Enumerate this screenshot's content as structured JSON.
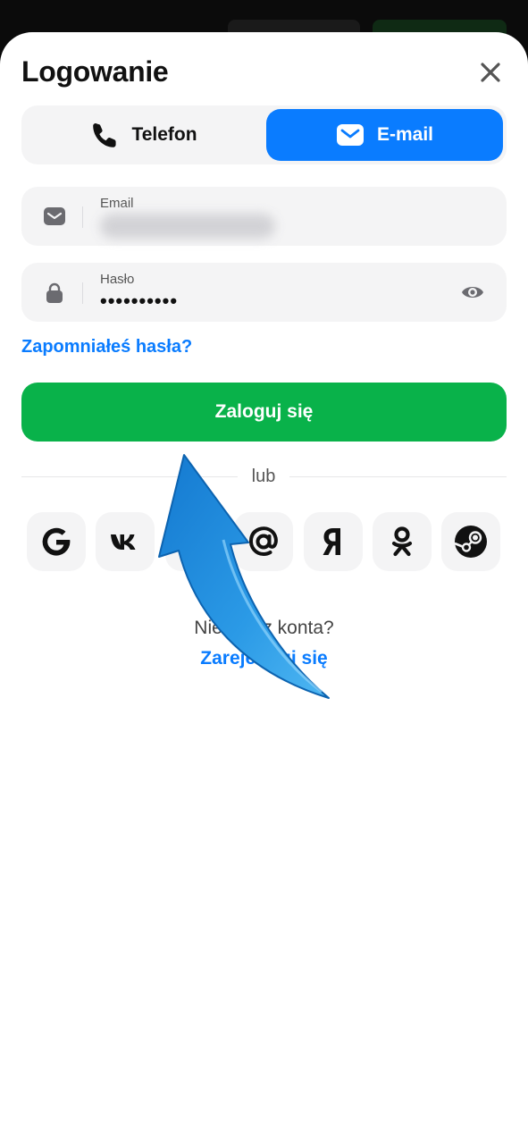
{
  "header": {
    "title": "Logowanie",
    "close_icon": "close-icon"
  },
  "tabs": [
    {
      "label": "Telefon",
      "icon": "phone-icon",
      "active": false
    },
    {
      "label": "E-mail",
      "icon": "mail-icon",
      "active": true
    }
  ],
  "form": {
    "email": {
      "label": "Email",
      "value_obscured": true
    },
    "password": {
      "label": "Hasło",
      "value": "••••••••••"
    },
    "forgot_label": "Zapomniałeś hasła?",
    "submit_label": "Zaloguj się"
  },
  "divider_label": "lub",
  "social_logins": [
    "google-icon",
    "vk-icon",
    "telegram-icon",
    "mail-ru-icon",
    "yandex-icon",
    "odnoklassniki-icon",
    "steam-icon"
  ],
  "footer": {
    "no_account": "Nie masz konta?",
    "register_label": "Zarejestruj się"
  },
  "colors": {
    "accent_blue": "#0a7cff",
    "submit_green": "#09b24a",
    "field_bg": "#f4f4f5",
    "annotation_arrow": "#1e8ad8"
  }
}
